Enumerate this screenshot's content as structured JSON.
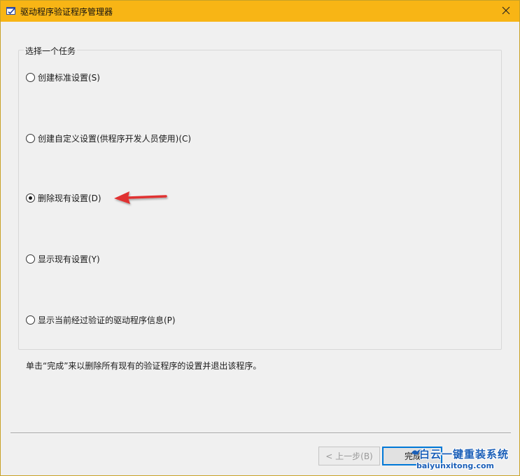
{
  "window": {
    "title": "驱动程序验证程序管理器"
  },
  "group": {
    "title": "选择一个任务",
    "options": [
      {
        "label": "创建标准设置(S)",
        "checked": false
      },
      {
        "label": "创建自定义设置(供程序开发人员使用)(C)",
        "checked": false
      },
      {
        "label": "删除现有设置(D)",
        "checked": true
      },
      {
        "label": "显示现有设置(Y)",
        "checked": false
      },
      {
        "label": "显示当前经过验证的驱动程序信息(P)",
        "checked": false
      }
    ]
  },
  "hint": "单击“完成”来以删除所有现有的验证程序的设置并退出该程序。",
  "buttons": {
    "back_label": "< 上一步(B)",
    "finish_label": "完成"
  },
  "watermark": {
    "top": "白云一键重装系统",
    "bottom": "baiyunxitong.com"
  },
  "colors": {
    "titlebar": "#f8b515",
    "annotation_arrow": "#e03131",
    "default_button_border": "#0078d7",
    "watermark": "#1b5fb8"
  },
  "icons": {
    "app": "app-icon",
    "close": "close-icon",
    "annotation": "red-arrow-icon"
  }
}
